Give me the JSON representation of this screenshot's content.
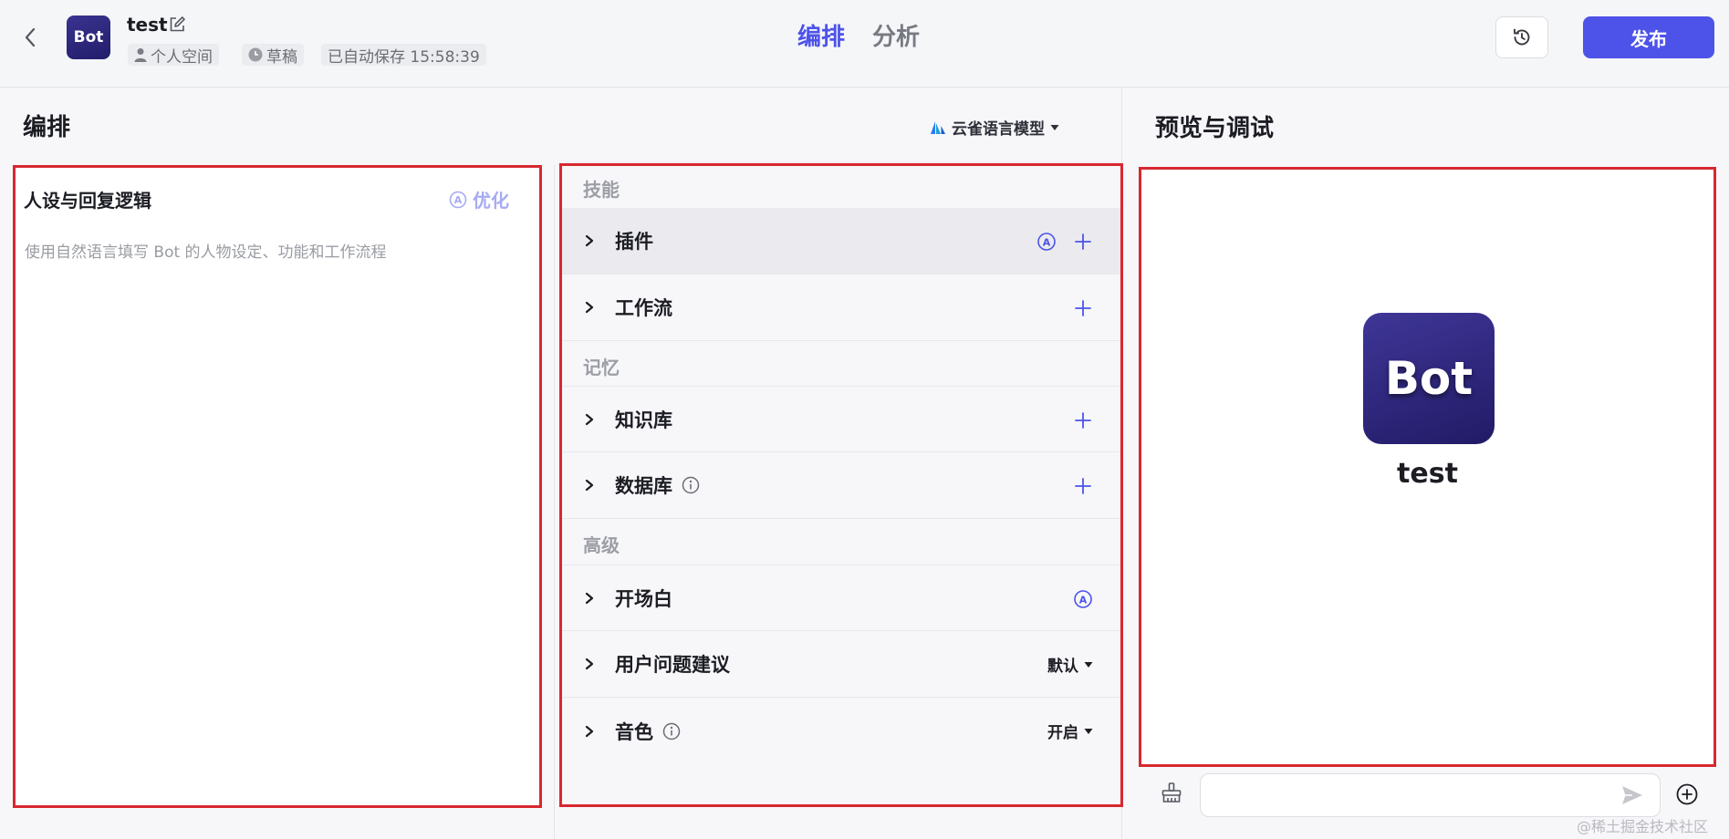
{
  "header": {
    "avatar_text": "Bot",
    "bot_name": "test",
    "space": "个人空间",
    "status": "草稿",
    "autosave": "已自动保存 15:58:39",
    "tabs": [
      {
        "label": "编排",
        "active": true
      },
      {
        "label": "分析",
        "active": false
      }
    ],
    "publish_label": "发布"
  },
  "editor": {
    "title": "编排",
    "model": "云雀语言模型"
  },
  "persona": {
    "title": "人设与回复逻辑",
    "optimize_label": "优化",
    "placeholder": "使用自然语言填写 Bot 的人物设定、功能和工作流程"
  },
  "skills": {
    "group_skill": "技能",
    "plugin": "插件",
    "workflow": "工作流",
    "group_memory": "记忆",
    "knowledge": "知识库",
    "database": "数据库",
    "group_advanced": "高级",
    "opening": "开场白",
    "suggestions": "用户问题建议",
    "suggestions_value": "默认",
    "voice": "音色",
    "voice_value": "开启"
  },
  "preview": {
    "title": "预览与调试",
    "avatar_text": "Bot",
    "bot_name": "test",
    "input_placeholder": ""
  },
  "watermark": "@稀土掘金技术社区",
  "colors": {
    "accent": "#4d53e8",
    "highlight_border": "#d7282f",
    "optimize_text": "#a7abf2"
  }
}
